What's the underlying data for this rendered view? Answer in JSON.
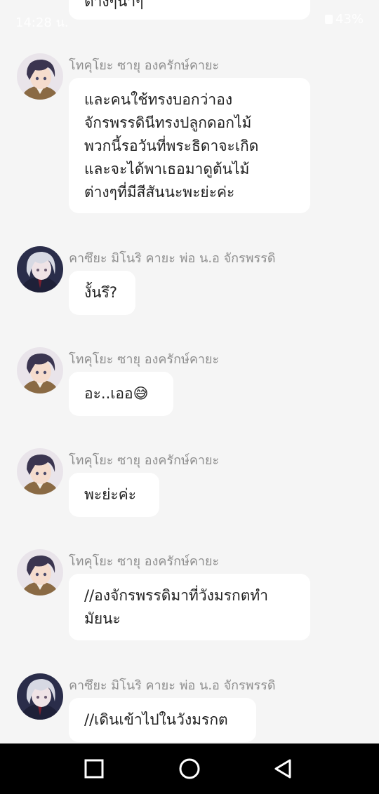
{
  "status_bar": {
    "time": "14:28 น.",
    "battery": "43%"
  },
  "top_bubble": {
    "text": "ต่างๆนาๆ"
  },
  "messages": [
    {
      "sender": "โทคุโยะ ซายุ องครักษ์คายะ",
      "text": "และคนใช้ทรงบอกว่าอง\nจักรพรรดินีทรงปลูกดอกไม้\nพวกนี้รอวันที่พระธิดาจะเกิด\nและจะได้พาเธอมาดูต้นไม้\nต่างๆที่มีสีสันนะพะย่ะค่ะ",
      "avatar": "brown-haired-boy-avatar"
    },
    {
      "sender": "คาซึยะ มิโนริ คายะ พ่อ น.อ จักรพรรดิ",
      "text": "งั้นรึ?",
      "avatar": "silver-haired-man-avatar"
    },
    {
      "sender": "โทคุโยะ ซายุ องครักษ์คายะ",
      "text": "อะ..เออ😅",
      "avatar": "brown-haired-boy-avatar"
    },
    {
      "sender": "โทคุโยะ ซายุ องครักษ์คายะ",
      "text": "พะย่ะค่ะ",
      "avatar": "brown-haired-boy-avatar"
    },
    {
      "sender": "โทคุโยะ ซายุ องครักษ์คายะ",
      "text": "//องจักรพรรดิมาที่วังมรกตทำ\nมัยนะ",
      "avatar": "brown-haired-boy-avatar"
    },
    {
      "sender": "คาซึยะ มิโนริ คายะ พ่อ น.อ จักรพรรดิ",
      "text": "//เดินเข้าไปในวังมรกต",
      "avatar": "silver-haired-man-avatar"
    }
  ],
  "nav_bar": {
    "buttons": [
      "recents-icon",
      "home-icon",
      "back-icon"
    ]
  }
}
